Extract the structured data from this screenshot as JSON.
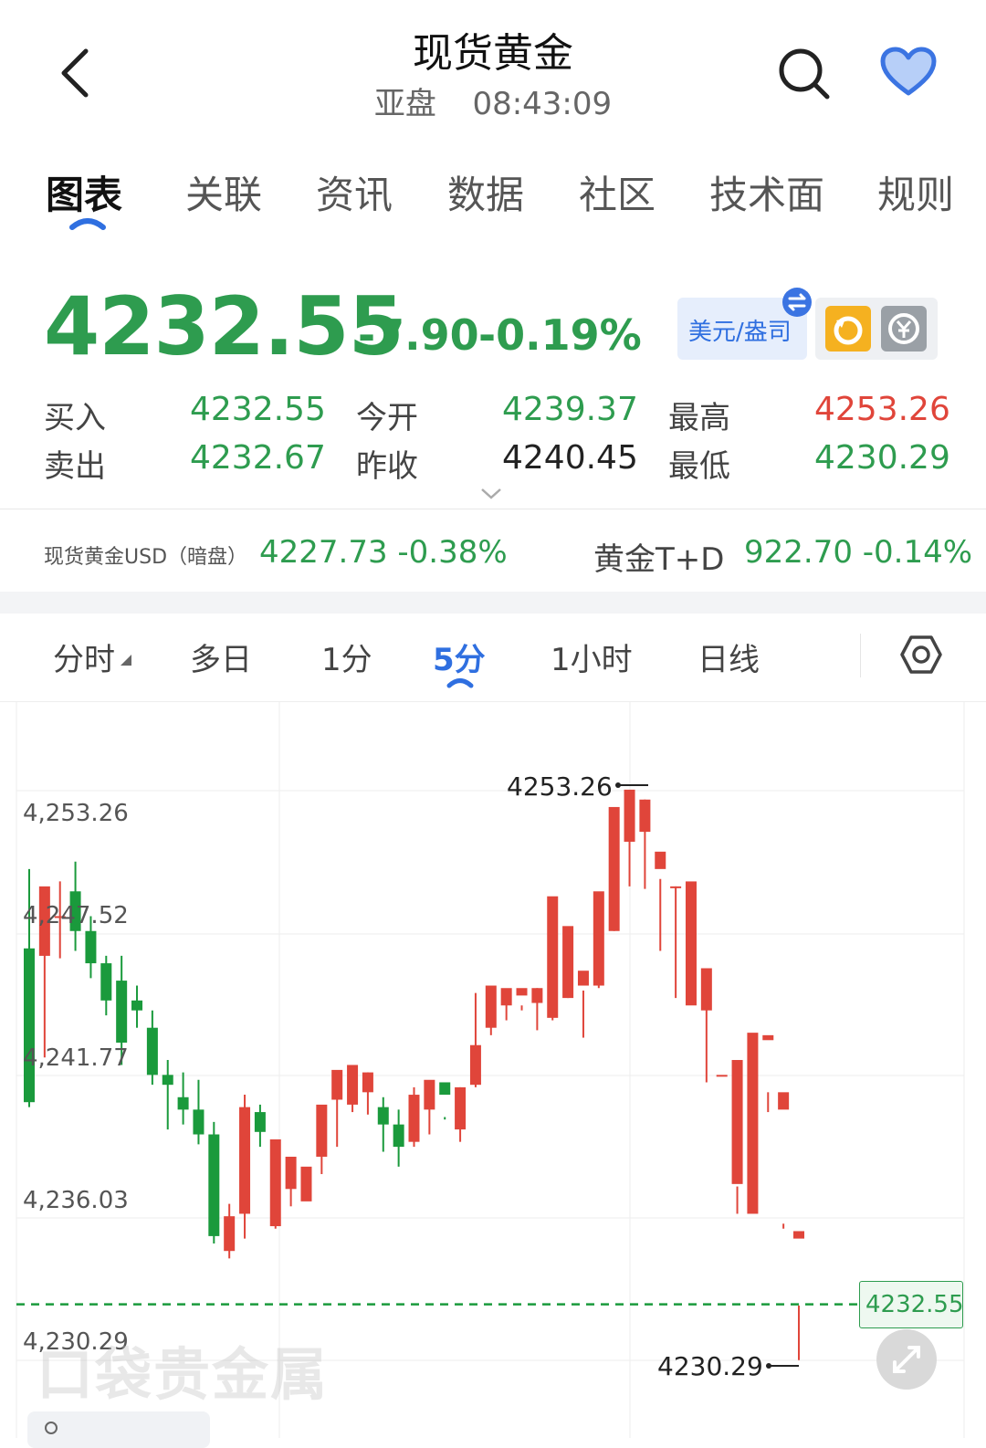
{
  "header": {
    "title": "现货黄金",
    "session": "亚盘",
    "time": "08:43:09"
  },
  "tabs": [
    "图表",
    "关联",
    "资讯",
    "数据",
    "社区",
    "技术面",
    "规则"
  ],
  "quote": {
    "price": "4232.55",
    "change": "-7.90",
    "change_pct": "-0.19%",
    "unit_button": "美元/盎司",
    "bid_label": "买入",
    "bid": "4232.55",
    "ask_label": "卖出",
    "ask": "4232.67",
    "open_label": "今开",
    "open": "4239.37",
    "prev_label": "昨收",
    "prev_close": "4240.45",
    "high_label": "最高",
    "high": "4253.26",
    "low_label": "最低",
    "low": "4230.29"
  },
  "related": {
    "item1_name": "现货黄金USD（暗盘）",
    "item1_value": "4227.73 -0.38%",
    "item2_name": "黄金T+D",
    "item2_value": "922.70 -0.14%"
  },
  "periods": [
    "分时",
    "多日",
    "1分",
    "5分",
    "1小时",
    "日线"
  ],
  "chart_data": {
    "type": "candlestick",
    "y_ticks": [
      "4,253.26",
      "4,247.52",
      "4,241.77",
      "4,236.03",
      "4,230.29"
    ],
    "ylim": [
      4230.29,
      4253.26
    ],
    "max_label": "4253.26",
    "min_label": "4230.29",
    "current_label": "4232.55",
    "current_price": 4232.55,
    "watermark": "口袋贵金属",
    "colors": {
      "up": "#e0453a",
      "down": "#1a9a3c",
      "current_line": "#1a9a3c"
    },
    "candles": [
      [
        4246.9,
        4250.1,
        4240.7,
        4240.5
      ],
      [
        4246.6,
        4248.1,
        4249.4,
        4242.5
      ],
      [
        4248.2,
        4249.6,
        4248.2,
        4246.5
      ],
      [
        4249.2,
        4250.4,
        4247.6,
        4246.8
      ],
      [
        4247.6,
        4248.2,
        4246.3,
        4245.7
      ],
      [
        4246.3,
        4246.6,
        4244.8,
        4244.2
      ],
      [
        4245.6,
        4246.6,
        4243.1,
        4242.2
      ],
      [
        4244.8,
        4245.4,
        4244.4,
        4243.7
      ],
      [
        4243.7,
        4244.4,
        4241.8,
        4241.4
      ],
      [
        4241.8,
        4242.4,
        4241.4,
        4239.6
      ],
      [
        4240.9,
        4241.9,
        4240.4,
        4239.8
      ],
      [
        4240.4,
        4241.6,
        4239.4,
        4239.0
      ],
      [
        4239.4,
        4239.9,
        4235.3,
        4235.0
      ],
      [
        4234.7,
        4236.6,
        4236.1,
        4234.4
      ],
      [
        4236.2,
        4241.0,
        4240.5,
        4235.2
      ],
      [
        4240.3,
        4240.6,
        4239.5,
        4238.9
      ],
      [
        4235.7,
        4238.9,
        4239.2,
        4235.6
      ],
      [
        4237.2,
        4237.6,
        4238.5,
        4236.5
      ],
      [
        4236.7,
        4238.0,
        4238.1,
        4236.9
      ],
      [
        4238.5,
        4239.3,
        4240.6,
        4237.8
      ],
      [
        4240.8,
        4241.5,
        4242.0,
        4238.9
      ],
      [
        4240.6,
        4241.8,
        4242.2,
        4240.3
      ],
      [
        4241.1,
        4241.9,
        4241.9,
        4240.2
      ],
      [
        4240.5,
        4240.9,
        4239.8,
        4238.7
      ],
      [
        4239.8,
        4240.4,
        4238.9,
        4238.1
      ],
      [
        4239.1,
        4241.3,
        4241.0,
        4238.9
      ],
      [
        4240.4,
        4240.8,
        4241.6,
        4239.4
      ],
      [
        4241.5,
        4240.1,
        4241.0,
        4240.0
      ],
      [
        4239.6,
        4241.3,
        4241.3,
        4239.1
      ],
      [
        4241.4,
        4245.1,
        4243.0,
        4241.3
      ],
      [
        4243.7,
        4245.0,
        4245.4,
        4243.4
      ],
      [
        4244.6,
        4244.9,
        4245.3,
        4244.0
      ],
      [
        4245.0,
        4244.6,
        4245.3,
        4244.4
      ],
      [
        4244.7,
        4245.3,
        4245.3,
        4243.6
      ],
      [
        4244.1,
        4246.2,
        4249.0,
        4244.0
      ],
      [
        4244.9,
        4245.9,
        4247.8,
        4244.9
      ],
      [
        4245.4,
        4245.2,
        4246.0,
        4243.3
      ],
      [
        4245.4,
        4247.4,
        4249.2,
        4245.3
      ],
      [
        4247.6,
        4251.6,
        4252.6,
        4247.6
      ],
      [
        4251.2,
        4251.6,
        4253.3,
        4249.4
      ],
      [
        4251.6,
        4252.9,
        4252.9,
        4249.3
      ],
      [
        4250.1,
        4249.7,
        4250.8,
        4246.8
      ],
      [
        4249.4,
        4249.4,
        4249.4,
        4244.9
      ],
      [
        4244.6,
        4249.3,
        4249.6,
        4244.8
      ],
      [
        4244.4,
        4245.3,
        4246.1,
        4241.5
      ],
      [
        4241.8,
        4240.6,
        4241.8,
        4240.6
      ],
      [
        4237.4,
        4236.2,
        4242.4,
        4237.3
      ],
      [
        4236.2,
        4236.9,
        4243.5,
        4236.5
      ],
      [
        4243.2,
        4241.1,
        4243.4,
        4240.3
      ],
      [
        4240.4,
        4235.8,
        4241.1,
        4235.6
      ],
      [
        4235.2,
        4230.3,
        4235.5,
        4232.5
      ]
    ]
  }
}
